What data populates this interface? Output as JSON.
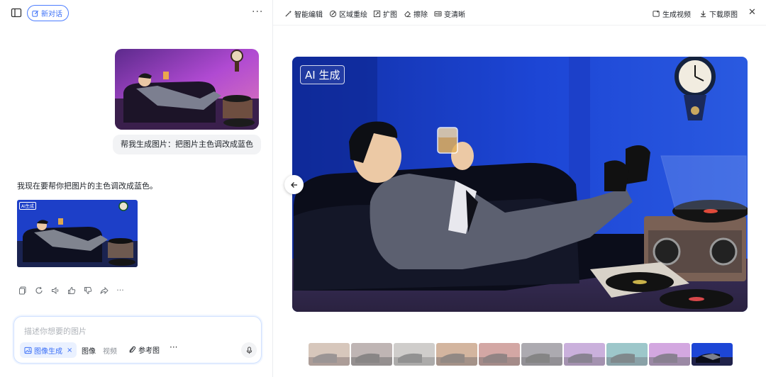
{
  "header": {
    "new_chat_label": "新对话"
  },
  "conversation": {
    "user_request": "帮我生成图片：把图片主色调改成蓝色",
    "ai_reply": "我现在要帮你把图片的主色调改成蓝色。",
    "ai_image_badge": "AI生成"
  },
  "composer": {
    "placeholder": "描述你想要的图片",
    "mode_chip_label": "图像生成",
    "segment_image": "图像",
    "segment_video": "视频",
    "reference_label": "参考图"
  },
  "toolbar": {
    "smart_edit": "智能编辑",
    "area_redraw": "区域重绘",
    "expand": "扩图",
    "erase": "擦除",
    "sharpen": "变清晰",
    "generate_video": "生成视频",
    "download_original": "下载原图"
  },
  "preview": {
    "badge": "AI 生成",
    "thumbnail_count": 10,
    "active_thumbnail": 10
  },
  "colors": {
    "accent": "#3a6ff7",
    "blue_scene": "#1d3fc8",
    "pink_scene": "#a04bd0"
  }
}
